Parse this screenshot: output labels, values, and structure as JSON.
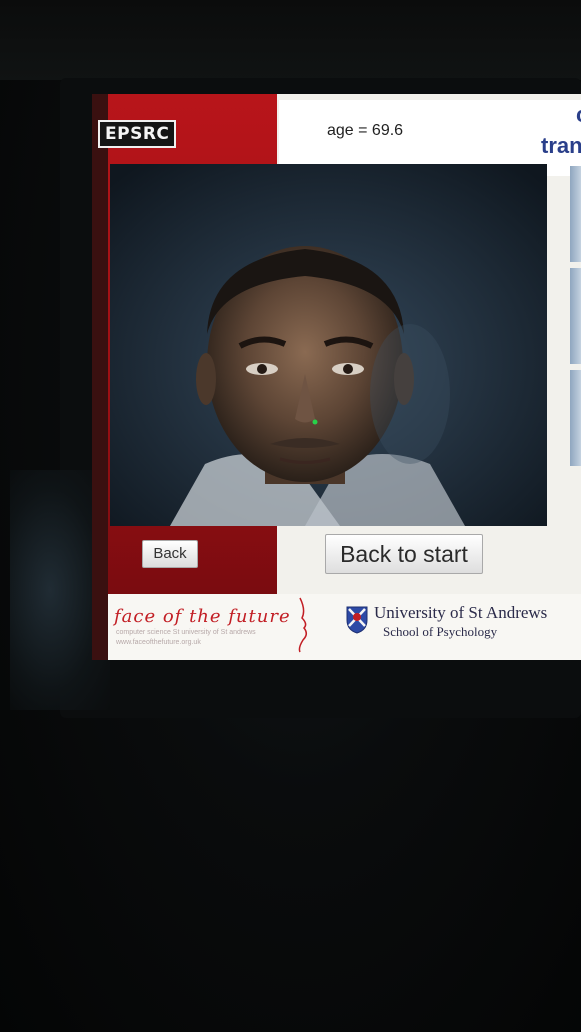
{
  "header": {
    "logo_text": "EPSRC",
    "age_label": "age = 69.6",
    "title_fragment_top": "c",
    "title_fragment": "tran"
  },
  "face": {
    "description_icon": "face-photo"
  },
  "buttons": {
    "back_label": "Back",
    "back_to_start_label": "Back to start"
  },
  "footer": {
    "face_of_future_title": "face of the future",
    "face_of_future_sub": "computer science St university of St andrews",
    "face_of_future_url": "www.faceofthefuture.org.uk",
    "university_name": "University of St Andrews",
    "school_name": "School of Psychology"
  },
  "colors": {
    "accent_red": "#b8151a",
    "title_blue": "#2a3f8a",
    "uni_navy": "#2b2b4a"
  }
}
